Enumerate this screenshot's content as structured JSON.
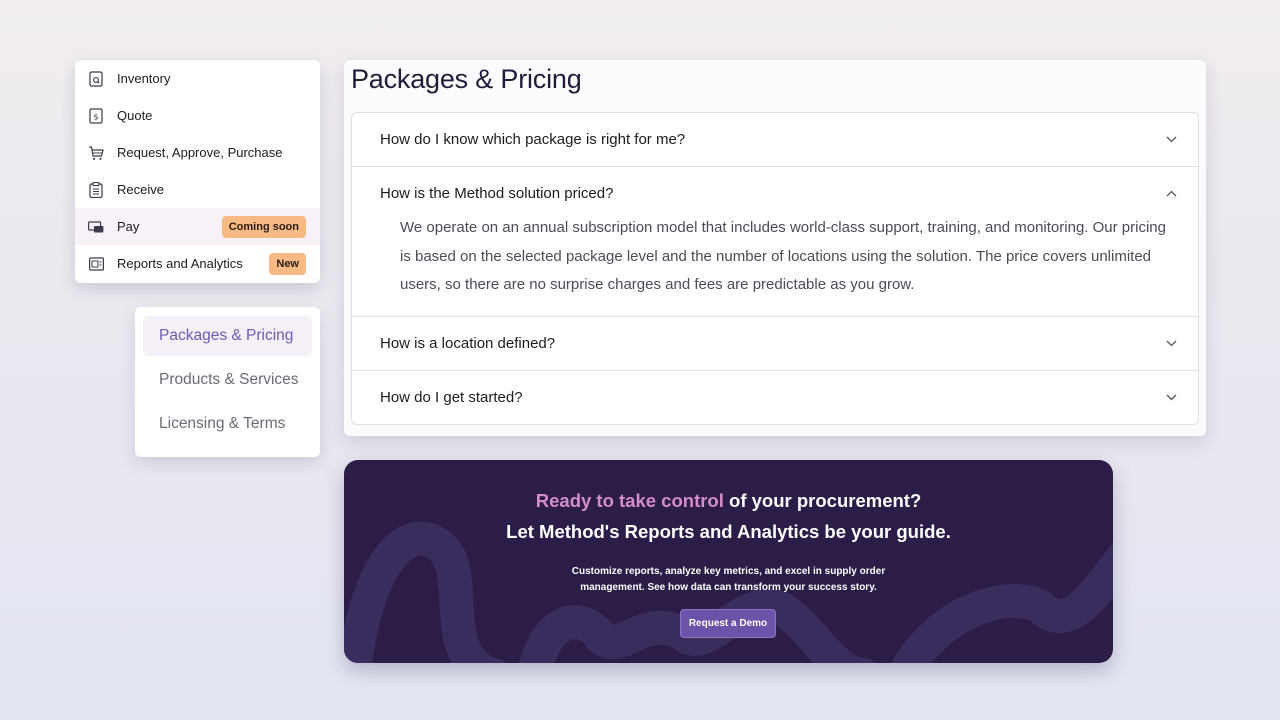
{
  "menu": {
    "items": [
      {
        "label": "Inventory",
        "icon": "inventory-doc-icon"
      },
      {
        "label": "Quote",
        "icon": "quote-doc-icon"
      },
      {
        "label": "Request, Approve, Purchase",
        "icon": "cart-icon"
      },
      {
        "label": "Receive",
        "icon": "clipboard-icon"
      },
      {
        "label": "Pay",
        "icon": "payment-card-icon",
        "badge": "Coming soon",
        "active": true
      },
      {
        "label": "Reports and Analytics",
        "icon": "report-chart-icon",
        "badge": "New"
      }
    ]
  },
  "subnav": {
    "items": [
      {
        "label": "Packages & Pricing",
        "active": true
      },
      {
        "label": "Products & Services"
      },
      {
        "label": "Licensing & Terms"
      }
    ]
  },
  "faq": {
    "title": "Packages & Pricing",
    "items": [
      {
        "question": "How do I know which package is right for me?",
        "expanded": false
      },
      {
        "question": "How is the Method solution priced?",
        "expanded": true,
        "answer": "We operate on an annual subscription model that includes world-class support, training, and monitoring. Our pricing is based on the selected package level and the number of locations using the solution. The price covers unlimited users, so there are no surprise charges and fees are predictable as you grow."
      },
      {
        "question": "How is a location defined?",
        "expanded": false
      },
      {
        "question": "How do I get started?",
        "expanded": false
      }
    ]
  },
  "cta": {
    "headline_highlight": "Ready to take control",
    "headline_rest": " of your procurement?",
    "subheadline": "Let Method's Reports and Analytics be your guide.",
    "description": "Customize reports, analyze key metrics, and excel in supply order management. See how data can transform your success story.",
    "button_label": "Request a Demo"
  },
  "colors": {
    "accent": "#6f59b6",
    "badge": "#f7ba84",
    "cta_bg": "#2b1d48",
    "cta_highlight": "#d48ccc",
    "cta_button": "#6a53a8"
  }
}
